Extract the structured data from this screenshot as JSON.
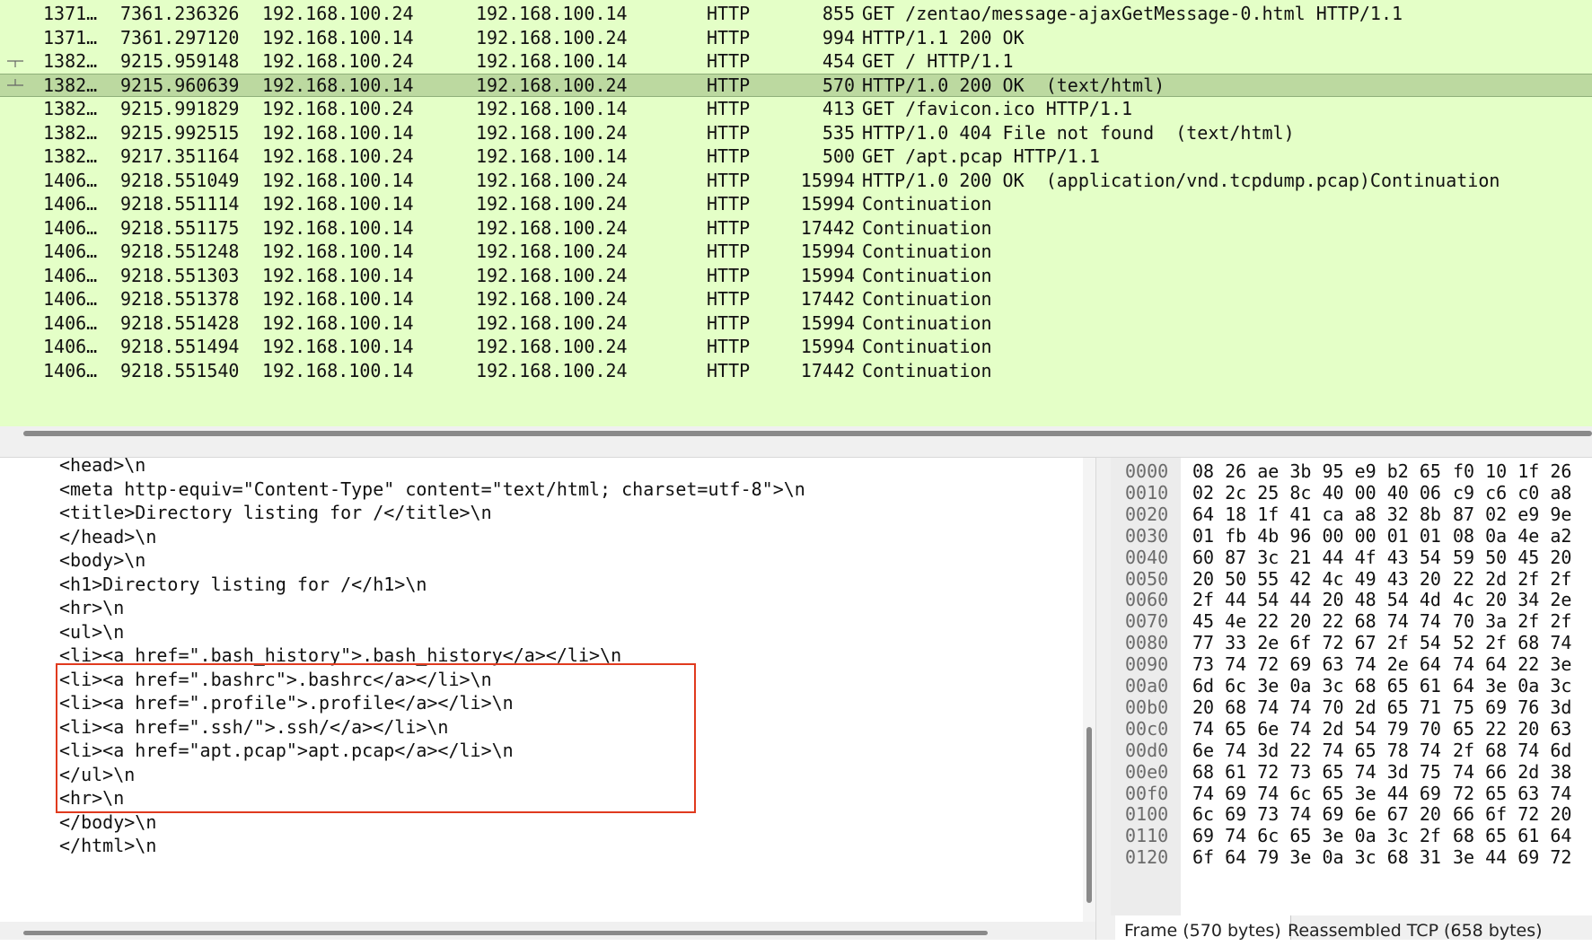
{
  "packet_list": {
    "rows": [
      {
        "no": "1371…",
        "time": "7361.236326",
        "src": "192.168.100.24",
        "dst": "192.168.100.14",
        "proto": "HTTP",
        "len": "855",
        "info": "GET /zentao/message-ajaxGetMessage-0.html HTTP/1.1"
      },
      {
        "no": "1371…",
        "time": "7361.297120",
        "src": "192.168.100.14",
        "dst": "192.168.100.24",
        "proto": "HTTP",
        "len": "994",
        "info": "HTTP/1.1 200 OK"
      },
      {
        "no": "1382…",
        "time": "9215.959148",
        "src": "192.168.100.24",
        "dst": "192.168.100.14",
        "proto": "HTTP",
        "len": "454",
        "info": "GET / HTTP/1.1"
      },
      {
        "no": "1382…",
        "time": "9215.960639",
        "src": "192.168.100.14",
        "dst": "192.168.100.24",
        "proto": "HTTP",
        "len": "570",
        "info": "HTTP/1.0 200 OK  (text/html)"
      },
      {
        "no": "1382…",
        "time": "9215.991829",
        "src": "192.168.100.24",
        "dst": "192.168.100.14",
        "proto": "HTTP",
        "len": "413",
        "info": "GET /favicon.ico HTTP/1.1"
      },
      {
        "no": "1382…",
        "time": "9215.992515",
        "src": "192.168.100.14",
        "dst": "192.168.100.24",
        "proto": "HTTP",
        "len": "535",
        "info": "HTTP/1.0 404 File not found  (text/html)"
      },
      {
        "no": "1382…",
        "time": "9217.351164",
        "src": "192.168.100.24",
        "dst": "192.168.100.14",
        "proto": "HTTP",
        "len": "500",
        "info": "GET /apt.pcap HTTP/1.1"
      },
      {
        "no": "1406…",
        "time": "9218.551049",
        "src": "192.168.100.14",
        "dst": "192.168.100.24",
        "proto": "HTTP",
        "len": "15994",
        "info": "HTTP/1.0 200 OK  (application/vnd.tcpdump.pcap)Continuation"
      },
      {
        "no": "1406…",
        "time": "9218.551114",
        "src": "192.168.100.14",
        "dst": "192.168.100.24",
        "proto": "HTTP",
        "len": "15994",
        "info": "Continuation"
      },
      {
        "no": "1406…",
        "time": "9218.551175",
        "src": "192.168.100.14",
        "dst": "192.168.100.24",
        "proto": "HTTP",
        "len": "17442",
        "info": "Continuation"
      },
      {
        "no": "1406…",
        "time": "9218.551248",
        "src": "192.168.100.14",
        "dst": "192.168.100.24",
        "proto": "HTTP",
        "len": "15994",
        "info": "Continuation"
      },
      {
        "no": "1406…",
        "time": "9218.551303",
        "src": "192.168.100.14",
        "dst": "192.168.100.24",
        "proto": "HTTP",
        "len": "15994",
        "info": "Continuation"
      },
      {
        "no": "1406…",
        "time": "9218.551378",
        "src": "192.168.100.14",
        "dst": "192.168.100.24",
        "proto": "HTTP",
        "len": "17442",
        "info": "Continuation"
      },
      {
        "no": "1406…",
        "time": "9218.551428",
        "src": "192.168.100.14",
        "dst": "192.168.100.24",
        "proto": "HTTP",
        "len": "15994",
        "info": "Continuation"
      },
      {
        "no": "1406…",
        "time": "9218.551494",
        "src": "192.168.100.14",
        "dst": "192.168.100.24",
        "proto": "HTTP",
        "len": "15994",
        "info": "Continuation"
      },
      {
        "no": "1406…",
        "time": "9218.551540",
        "src": "192.168.100.14",
        "dst": "192.168.100.24",
        "proto": "HTTP",
        "len": "17442",
        "info": "Continuation"
      }
    ],
    "selected_row": 3,
    "colors": {
      "row_bg": "#e4ffc7",
      "selected_bg": "#bcd9a0"
    }
  },
  "text_pane": {
    "lines": [
      "<head>\\n",
      "<meta http-equiv=\"Content-Type\" content=\"text/html; charset=utf-8\">\\n",
      "<title>Directory listing for /</title>\\n",
      "</head>\\n",
      "<body>\\n",
      "<h1>Directory listing for /</h1>\\n",
      "<hr>\\n",
      "<ul>\\n",
      "<li><a href=\".bash_history\">.bash_history</a></li>\\n",
      "<li><a href=\".bashrc\">.bashrc</a></li>\\n",
      "<li><a href=\".profile\">.profile</a></li>\\n",
      "<li><a href=\".ssh/\">.ssh/</a></li>\\n",
      "<li><a href=\"apt.pcap\">apt.pcap</a></li>\\n",
      "</ul>\\n",
      "<hr>\\n",
      "</body>\\n",
      "</html>\\n"
    ],
    "highlight_color": "#e03a1e"
  },
  "hex_pane": {
    "rows": [
      {
        "offset": "0000",
        "bytes": "08 26 ae 3b 95 e9 b2 65",
        "bytes2": "f0 10 1f 26"
      },
      {
        "offset": "0010",
        "bytes": "02 2c 25 8c 40 00 40 06",
        "bytes2": "c9 c6 c0 a8"
      },
      {
        "offset": "0020",
        "bytes": "64 18 1f 41 ca a8 32 8b",
        "bytes2": "87 02 e9 9e"
      },
      {
        "offset": "0030",
        "bytes": "01 fb 4b 96 00 00 01 01",
        "bytes2": "08 0a 4e a2"
      },
      {
        "offset": "0040",
        "bytes": "60 87 3c 21 44 4f 43 54",
        "bytes2": "59 50 45 20"
      },
      {
        "offset": "0050",
        "bytes": "20 50 55 42 4c 49 43 20",
        "bytes2": "22 2d 2f 2f"
      },
      {
        "offset": "0060",
        "bytes": "2f 44 54 44 20 48 54 4d",
        "bytes2": "4c 20 34 2e"
      },
      {
        "offset": "0070",
        "bytes": "45 4e 22 20 22 68 74 74",
        "bytes2": "70 3a 2f 2f"
      },
      {
        "offset": "0080",
        "bytes": "77 33 2e 6f 72 67 2f 54",
        "bytes2": "52 2f 68 74"
      },
      {
        "offset": "0090",
        "bytes": "73 74 72 69 63 74 2e 64",
        "bytes2": "74 64 22 3e"
      },
      {
        "offset": "00a0",
        "bytes": "6d 6c 3e 0a 3c 68 65 61",
        "bytes2": "64 3e 0a 3c"
      },
      {
        "offset": "00b0",
        "bytes": "20 68 74 74 70 2d 65 71",
        "bytes2": "75 69 76 3d"
      },
      {
        "offset": "00c0",
        "bytes": "74 65 6e 74 2d 54 79 70",
        "bytes2": "65 22 20 63"
      },
      {
        "offset": "00d0",
        "bytes": "6e 74 3d 22 74 65 78 74",
        "bytes2": "2f 68 74 6d"
      },
      {
        "offset": "00e0",
        "bytes": "68 61 72 73 65 74 3d 75",
        "bytes2": "74 66 2d 38"
      },
      {
        "offset": "00f0",
        "bytes": "74 69 74 6c 65 3e 44 69",
        "bytes2": "72 65 63 74"
      },
      {
        "offset": "0100",
        "bytes": "6c 69 73 74 69 6e 67 20",
        "bytes2": "66 6f 72 20"
      },
      {
        "offset": "0110",
        "bytes": "69 74 6c 65 3e 0a 3c 2f",
        "bytes2": "68 65 61 64"
      },
      {
        "offset": "0120",
        "bytes": "6f 64 79 3e 0a 3c 68 31",
        "bytes2": "3e 44 69 72"
      }
    ],
    "tabs": {
      "frame": "Frame (570 bytes)",
      "reassembled": "Reassembled TCP (658 bytes)"
    }
  }
}
